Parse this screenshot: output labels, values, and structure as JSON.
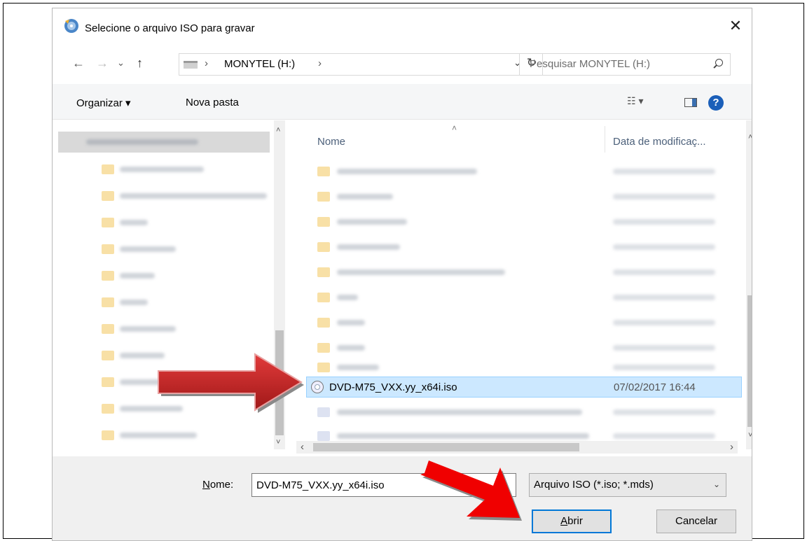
{
  "dialog": {
    "title": "Selecione o arquivo ISO para gravar",
    "close_symbol": "✕"
  },
  "navigation": {
    "back": "←",
    "forward": "→",
    "recent": "⌄",
    "up": "↑",
    "path_separator": "›",
    "crumb": "MONYTEL (H:)",
    "dropdown": "⌄",
    "refresh": "↻",
    "search_placeholder": "Pesquisar MONYTEL (H:)"
  },
  "toolbar": {
    "organize_label": "Organizar ▾",
    "new_folder_label": "Nova pasta",
    "view_label": "☷ ▾",
    "help_label": "?"
  },
  "file_list": {
    "col_name": "Nome",
    "col_date": "Data de modificaç...",
    "selected_file": {
      "name": "DVD-M75_VXX.yy_x64i.iso",
      "date": "07/02/2017 16:44"
    }
  },
  "scroll": {
    "up": "˄",
    "down": "˅",
    "left": "‹",
    "right": "›"
  },
  "footer": {
    "name_label_underlined": "N",
    "name_label_rest": "ome:",
    "file_name_value": "DVD-M75_VXX.yy_x64i.iso",
    "file_type_value": "Arquivo ISO (*.iso; *.mds)",
    "type_dropdown": "⌄",
    "open_underlined": "A",
    "open_rest": "brir",
    "cancel_label": "Cancelar"
  },
  "colors": {
    "selection": "#cce8ff",
    "annotation_arrow": "#e00000",
    "primary_button_border": "#0078d7"
  },
  "icons": [
    "iso-burner-app-icon",
    "close-icon",
    "back-arrow-icon",
    "forward-arrow-icon",
    "up-arrow-icon",
    "drive-icon",
    "refresh-icon",
    "search-icon",
    "view-options-icon",
    "preview-pane-icon",
    "help-icon",
    "folder-icon",
    "disc-image-icon"
  ]
}
